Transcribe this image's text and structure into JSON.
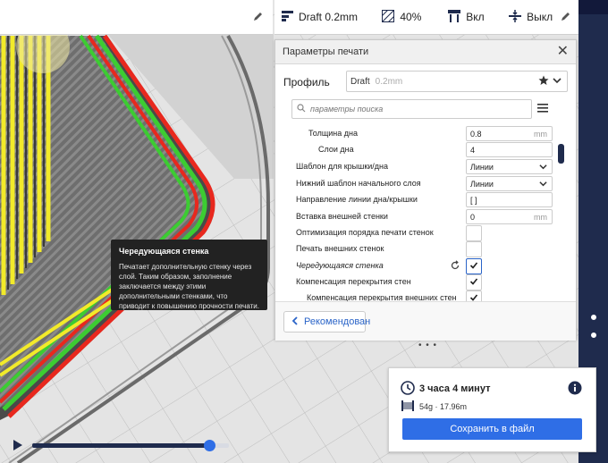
{
  "topbar": {
    "profile_label": "Draft 0.2mm",
    "infill_label": "40%",
    "support_label": "Вкл",
    "adhesion_label": "Выкл"
  },
  "panel": {
    "title": "Параметры печати",
    "profile_label": "Профиль",
    "profile_name": "Draft",
    "profile_quality": "0.2mm",
    "search_placeholder": "параметры поиска",
    "recommended_label": "Рекомендован"
  },
  "settings": [
    {
      "label": "Толщина дна",
      "value": "0.8",
      "unit": "mm"
    },
    {
      "label": "Слои дна",
      "value": "4"
    },
    {
      "label": "Шаблон для крышки/дна",
      "value": "Линии"
    },
    {
      "label": "Нижний шаблон начального слоя",
      "value": "Линии"
    },
    {
      "label": "Направление линии дна/крышки",
      "value": "[ ]"
    },
    {
      "label": "Вставка внешней стенки",
      "value": "0",
      "unit": "mm"
    },
    {
      "label": "Оптимизация порядка печати стенок",
      "checked": false
    },
    {
      "label": "Печать внешних стенок",
      "checked": false
    },
    {
      "label": "Чередующаяся стенка",
      "checked": true
    },
    {
      "label": "Компенсация перекрытия стен",
      "checked": true
    },
    {
      "label": "Компенсация перекрытия внешних стен",
      "checked": true
    }
  ],
  "tooltip": {
    "title": "Чередующаяся стенка",
    "description": "Печатает дополнительную стенку через слой. Таким образом, заполнение заключается между этими дополнительными стенками, что приводит к повышению прочности печати."
  },
  "job": {
    "time": "3 часа 4 минут",
    "material": "54g · 17.96m",
    "save_label": "Сохранить в файл"
  },
  "simulation": {
    "progress": 0.9
  },
  "colors": {
    "accent": "#2f6ee6",
    "dark": "#1f2b4d",
    "wall_red": "#e8281e",
    "wall_green": "#3ccc32",
    "wall_yellow": "#f2ea2a"
  }
}
